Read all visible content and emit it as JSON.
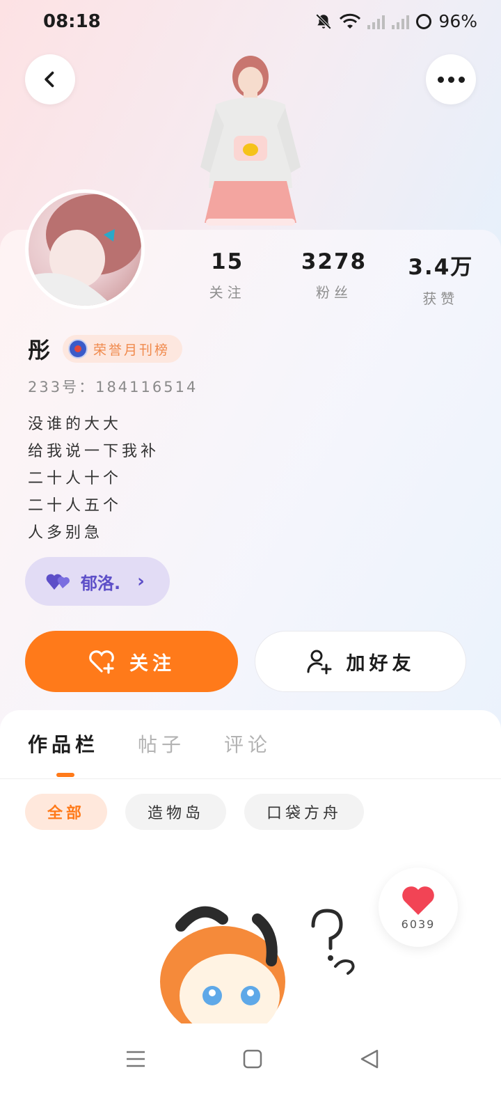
{
  "status_bar": {
    "time": "08:18",
    "battery": "96%"
  },
  "profile": {
    "stats": [
      {
        "value": "15",
        "label": "关注"
      },
      {
        "value": "3278",
        "label": "粉丝"
      },
      {
        "value": "3.4万",
        "label": "获赞"
      }
    ],
    "username": "彤",
    "badge": "荣誉月刊榜",
    "uid": "233号：184116514",
    "bio_lines": [
      "没谁的大大",
      "给我说一下我补",
      "二十人十个",
      "二十人五个",
      "人多别急"
    ],
    "tag": "郁洛."
  },
  "actions": {
    "follow": "关注",
    "add_friend": "加好友"
  },
  "tabs": [
    "作品栏",
    "帖子",
    "评论"
  ],
  "filters": [
    "全部",
    "造物岛",
    "口袋方舟"
  ],
  "like": {
    "count": "6039"
  },
  "colors": {
    "accent": "#ff7a1a",
    "tag_bg": "#e2dcf5",
    "tag_fg": "#5d4fc8",
    "like": "#f24455"
  }
}
